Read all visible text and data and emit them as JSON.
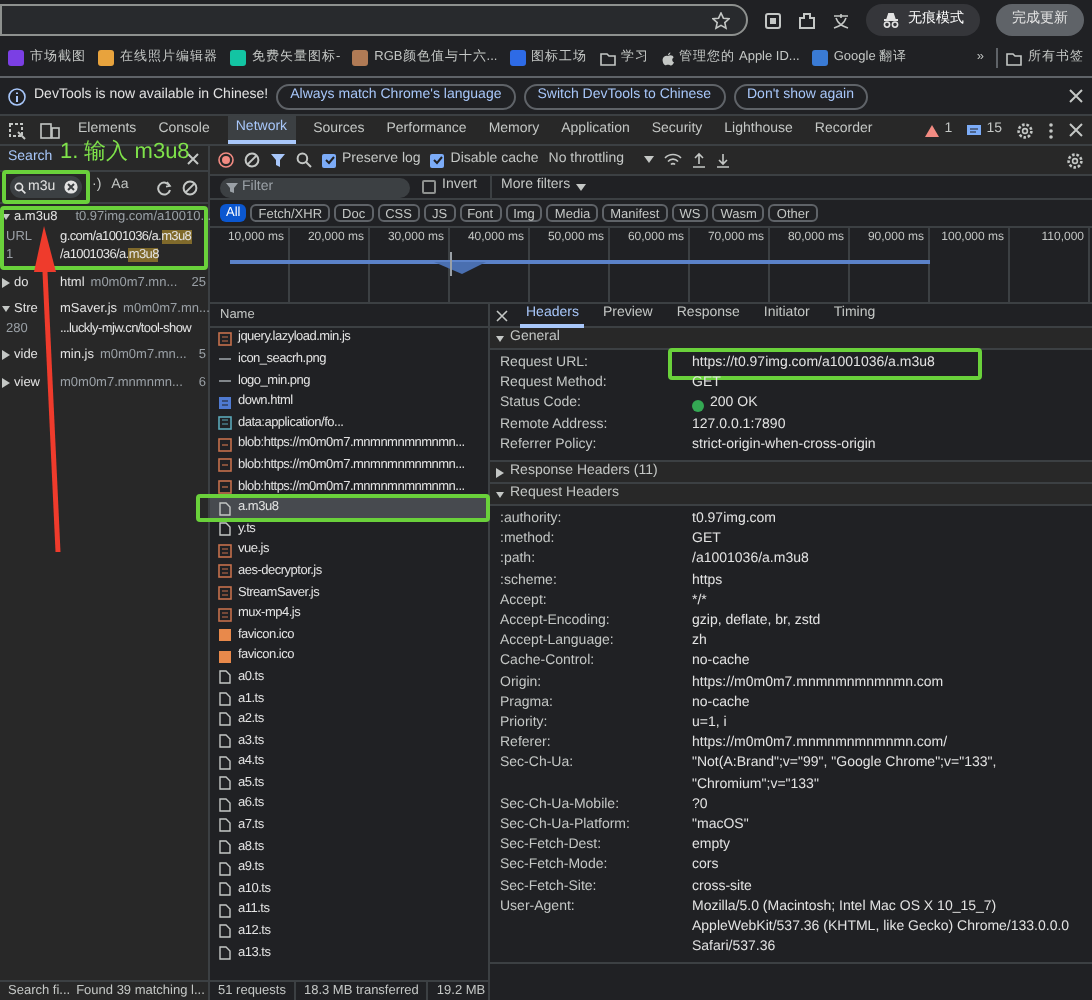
{
  "browser": {
    "incognito_label": "无痕模式",
    "update_button": "完成更新"
  },
  "bookmarks": [
    {
      "label": "市场截图",
      "kind": "app"
    },
    {
      "label": "在线照片编辑器",
      "kind": "app"
    },
    {
      "label": "免费矢量图标-",
      "kind": "app"
    },
    {
      "label": "RGB颜色值与十六...",
      "kind": "app"
    },
    {
      "label": "图标工场",
      "kind": "app"
    },
    {
      "label": "学习",
      "kind": "folder"
    },
    {
      "label": "管理您的 Apple ID...",
      "kind": "apple"
    },
    {
      "label": "Google 翻译",
      "kind": "app"
    }
  ],
  "bookmarks_more": "»",
  "all_bookmarks": "所有书签",
  "infobar": {
    "message": "DevTools is now available in Chinese!",
    "buttons": [
      "Always match Chrome's language",
      "Switch DevTools to Chinese",
      "Don't show again"
    ]
  },
  "devtools_tabs": [
    {
      "label": "Elements",
      "selected": false
    },
    {
      "label": "Console",
      "selected": false
    },
    {
      "label": "Network",
      "selected": true
    },
    {
      "label": "Sources",
      "selected": false
    },
    {
      "label": "Performance",
      "selected": false
    },
    {
      "label": "Memory",
      "selected": false
    },
    {
      "label": "Application",
      "selected": false
    },
    {
      "label": "Security",
      "selected": false
    },
    {
      "label": "Lighthouse",
      "selected": false
    },
    {
      "label": "Recorder",
      "selected": false
    }
  ],
  "warnings": "1",
  "messages": "15",
  "search_panel": {
    "title": "Search",
    "annotation": "1. 输入 m3u8",
    "query": "m3u",
    "query_highlighted": true,
    "regex_label": "·)",
    "case_label": "Aa",
    "results": [
      {
        "file": "a.m3u8",
        "origin": "t0.97img.com/a10010...",
        "expanded": true,
        "highlighted": true,
        "matches": [
          {
            "line": "URL",
            "pre": "g.com/a1001036/a.",
            "hit": "m3u8"
          },
          {
            "line": "1",
            "pre": "/a1001036/a.",
            "hit": "m3u8"
          }
        ]
      },
      {
        "file": "do",
        "file_end": "html",
        "origin": "m0m0m7.mn...",
        "count": "25",
        "expanded": false,
        "highlighted": false
      },
      {
        "file": "Stre",
        "file_end": "mSaver.js",
        "origin": "m0m0m7.mn...",
        "expanded": true,
        "highlighted": false,
        "matches": [
          {
            "line": "280",
            "pre": "...luckly-mjw.cn/tool-show"
          }
        ]
      },
      {
        "file": "vide",
        "file_end": "min.js",
        "origin": "m0m0m7.mn...",
        "count": "5",
        "expanded": false,
        "highlighted": false
      },
      {
        "file": "view",
        "origin": "m0m0m7.mnmnmn...",
        "count": "6",
        "expanded": false,
        "highlighted": false
      }
    ],
    "status": [
      "Search fi...",
      "Found 39 matching l..."
    ]
  },
  "toolbar": {
    "preserve_log": {
      "label": "Preserve log",
      "checked": true
    },
    "disable_cache": {
      "label": "Disable cache",
      "checked": true
    },
    "throttling": "No throttling"
  },
  "filter": {
    "placeholder": "Filter",
    "invert": {
      "label": "Invert",
      "checked": false
    },
    "more_filters": "More filters"
  },
  "type_filters": [
    {
      "label": "All",
      "selected": true
    },
    {
      "label": "Fetch/XHR",
      "selected": false
    },
    {
      "label": "Doc",
      "selected": false
    },
    {
      "label": "CSS",
      "selected": false
    },
    {
      "label": "JS",
      "selected": false
    },
    {
      "label": "Font",
      "selected": false
    },
    {
      "label": "Img",
      "selected": false
    },
    {
      "label": "Media",
      "selected": false
    },
    {
      "label": "Manifest",
      "selected": false
    },
    {
      "label": "WS",
      "selected": false
    },
    {
      "label": "Wasm",
      "selected": false
    },
    {
      "label": "Other",
      "selected": false
    }
  ],
  "timeline_ticks": [
    "10,000 ms",
    "20,000 ms",
    "30,000 ms",
    "40,000 ms",
    "50,000 ms",
    "60,000 ms",
    "70,000 ms",
    "80,000 ms",
    "90,000 ms",
    "100,000 ms",
    "110,000"
  ],
  "requests_header": "Name",
  "requests": [
    {
      "name": "jquery.lazyload.min.js",
      "kind": "script",
      "selected": false,
      "highlighted": false
    },
    {
      "name": "icon_seacrh.png",
      "kind": "image",
      "selected": false,
      "highlighted": false
    },
    {
      "name": "logo_min.png",
      "kind": "image",
      "selected": false,
      "highlighted": false
    },
    {
      "name": "down.html",
      "kind": "doc",
      "selected": false,
      "highlighted": false
    },
    {
      "name": "data:application/fo...",
      "kind": "data",
      "selected": false,
      "highlighted": false
    },
    {
      "name": "blob:https://m0m0m7.mnmnmnmnmnmn...",
      "kind": "blob",
      "selected": false,
      "highlighted": false
    },
    {
      "name": "blob:https://m0m0m7.mnmnmnmnmnmn...",
      "kind": "blob",
      "selected": false,
      "highlighted": false
    },
    {
      "name": "blob:https://m0m0m7.mnmnmnmnmnmn...",
      "kind": "blob",
      "selected": false,
      "highlighted": false
    },
    {
      "name": "a.m3u8",
      "kind": "file",
      "selected": true,
      "highlighted": true
    },
    {
      "name": "y.ts",
      "kind": "file",
      "selected": false,
      "highlighted": false
    },
    {
      "name": "vue.js",
      "kind": "script",
      "selected": false,
      "highlighted": false
    },
    {
      "name": "aes-decryptor.js",
      "kind": "script",
      "selected": false,
      "highlighted": false
    },
    {
      "name": "StreamSaver.js",
      "kind": "script",
      "selected": false,
      "highlighted": false
    },
    {
      "name": "mux-mp4.js",
      "kind": "script",
      "selected": false,
      "highlighted": false
    },
    {
      "name": "favicon.ico",
      "kind": "ico",
      "selected": false,
      "highlighted": false
    },
    {
      "name": "favicon.ico",
      "kind": "ico",
      "selected": false,
      "highlighted": false
    },
    {
      "name": "a0.ts",
      "kind": "file",
      "selected": false,
      "highlighted": false
    },
    {
      "name": "a1.ts",
      "kind": "file",
      "selected": false,
      "highlighted": false
    },
    {
      "name": "a2.ts",
      "kind": "file",
      "selected": false,
      "highlighted": false
    },
    {
      "name": "a3.ts",
      "kind": "file",
      "selected": false,
      "highlighted": false
    },
    {
      "name": "a4.ts",
      "kind": "file",
      "selected": false,
      "highlighted": false
    },
    {
      "name": "a5.ts",
      "kind": "file",
      "selected": false,
      "highlighted": false
    },
    {
      "name": "a6.ts",
      "kind": "file",
      "selected": false,
      "highlighted": false
    },
    {
      "name": "a7.ts",
      "kind": "file",
      "selected": false,
      "highlighted": false
    },
    {
      "name": "a8.ts",
      "kind": "file",
      "selected": false,
      "highlighted": false
    },
    {
      "name": "a9.ts",
      "kind": "file",
      "selected": false,
      "highlighted": false
    },
    {
      "name": "a10.ts",
      "kind": "file",
      "selected": false,
      "highlighted": false
    },
    {
      "name": "a11.ts",
      "kind": "file",
      "selected": false,
      "highlighted": false
    },
    {
      "name": "a12.ts",
      "kind": "file",
      "selected": false,
      "highlighted": false
    },
    {
      "name": "a13.ts",
      "kind": "file",
      "selected": false,
      "highlighted": false
    }
  ],
  "summary": [
    "51 requests",
    "18.3 MB transferred",
    "19.2 MB"
  ],
  "detail_tabs": [
    {
      "label": "Headers",
      "selected": true
    },
    {
      "label": "Preview",
      "selected": false
    },
    {
      "label": "Response",
      "selected": false
    },
    {
      "label": "Initiator",
      "selected": false
    },
    {
      "label": "Timing",
      "selected": false
    }
  ],
  "sections": [
    {
      "title": "General",
      "expanded": true,
      "rows": [
        {
          "name": "Request URL:",
          "value": "https://t0.97img.com/a1001036/a.m3u8",
          "highlighted": true
        },
        {
          "name": "Request Method:",
          "value": "GET",
          "highlighted": false
        },
        {
          "name": "Status Code:",
          "value": "200 OK",
          "color": "#34a853",
          "highlighted": false
        },
        {
          "name": "Remote Address:",
          "value": "127.0.0.1:7890",
          "highlighted": false
        },
        {
          "name": "Referrer Policy:",
          "value": "strict-origin-when-cross-origin",
          "highlighted": false
        }
      ]
    },
    {
      "title": "Response Headers (11)",
      "expanded": false
    },
    {
      "title": "Request Headers",
      "expanded": true,
      "rows": [
        {
          "name": ":authority:",
          "value": "t0.97img.com"
        },
        {
          "name": ":method:",
          "value": "GET"
        },
        {
          "name": ":path:",
          "value": "/a1001036/a.m3u8"
        },
        {
          "name": ":scheme:",
          "value": "https"
        },
        {
          "name": "Accept:",
          "value": "*/*"
        },
        {
          "name": "Accept-Encoding:",
          "value": "gzip, deflate, br, zstd"
        },
        {
          "name": "Accept-Language:",
          "value": "zh"
        },
        {
          "name": "Cache-Control:",
          "value": "no-cache"
        },
        {
          "name": "Origin:",
          "value": "https://m0m0m7.mnmnmnmnmnmn.com"
        },
        {
          "name": "Pragma:",
          "value": "no-cache"
        },
        {
          "name": "Priority:",
          "value": "u=1, i"
        },
        {
          "name": "Referer:",
          "value": "https://m0m0m7.mnmnmnmnmnmn.com/"
        },
        {
          "name": "Sec-Ch-Ua:",
          "value": "\"Not(A:Brand\";v=\"99\", \"Google Chrome\";v=\"133\", \"Chromium\";v=\"133\""
        },
        {
          "name": "Sec-Ch-Ua-Mobile:",
          "value": "?0"
        },
        {
          "name": "Sec-Ch-Ua-Platform:",
          "value": "\"macOS\""
        },
        {
          "name": "Sec-Fetch-Dest:",
          "value": "empty"
        },
        {
          "name": "Sec-Fetch-Mode:",
          "value": "cors"
        },
        {
          "name": "Sec-Fetch-Site:",
          "value": "cross-site"
        },
        {
          "name": "User-Agent:",
          "value": "Mozilla/5.0 (Macintosh; Intel Mac OS X 10_15_7) AppleWebKit/537.36 (KHTML, like Gecko) Chrome/133.0.0.0 Safari/537.36"
        }
      ]
    }
  ]
}
